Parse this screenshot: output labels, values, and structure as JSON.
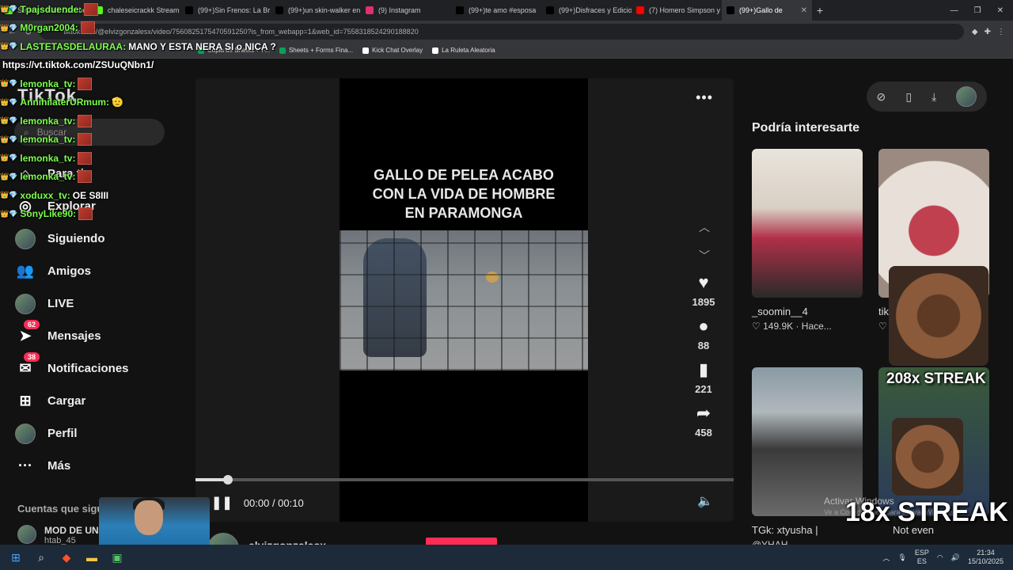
{
  "browser": {
    "tabs": [
      {
        "label": "Stream - Kick Dashbo",
        "color": "#53fc18"
      },
      {
        "label": "chaleseicrackk Stream",
        "color": "#53fc18"
      },
      {
        "label": "(99+)Sin Frenos: La Br",
        "color": "#000000"
      },
      {
        "label": "(99+)un skin-walker en",
        "color": "#000000"
      },
      {
        "label": "(9) Instagram",
        "color": "#e1306c"
      },
      {
        "label": "(99+)te amo #esposa",
        "color": "#000000"
      },
      {
        "label": "(99+)Disfraces y Edicio",
        "color": "#000000"
      },
      {
        "label": "(7) Homero Simpson y",
        "color": "#ff0000"
      },
      {
        "label": "(99+)Gallo de",
        "color": "#000000",
        "active": true
      }
    ],
    "new_tab_tooltip": "Nueva pestaña",
    "url": "tiktok.com/@elvizgonzalesx/video/7560825175470591250?is_from_webapp=1&web_id=7558318524290188820",
    "bookmarks": [
      {
        "label": "Copia de Sheets + F...",
        "color": "#0f9d58"
      },
      {
        "label": "Sheets + Forms Fina...",
        "color": "#0f9d58"
      },
      {
        "label": "Kick Chat Overlay",
        "color": "#ffffff"
      },
      {
        "label": "La Ruleta Aleatoria",
        "color": "#ffffff"
      }
    ]
  },
  "tiktok": {
    "logo": "TikTok",
    "search_placeholder": "Buscar",
    "nav": [
      {
        "icon": "home-icon",
        "glyph": "⌂",
        "label": "Para ti"
      },
      {
        "icon": "compass-icon",
        "glyph": "◎",
        "label": "Explorar"
      },
      {
        "icon": "avatar",
        "glyph": "",
        "label": "Siguiendo"
      },
      {
        "icon": "friends-icon",
        "glyph": "👥",
        "label": "Amigos"
      },
      {
        "icon": "live-avatar",
        "glyph": "",
        "label": "LIVE"
      },
      {
        "icon": "send-icon",
        "glyph": "➤",
        "label": "Mensajes",
        "badge": "62"
      },
      {
        "icon": "inbox-icon",
        "glyph": "✉",
        "label": "Notificaciones",
        "badge": "38"
      },
      {
        "icon": "plus-square-icon",
        "glyph": "⊞",
        "label": "Cargar"
      },
      {
        "icon": "avatar",
        "glyph": "",
        "label": "Perfil"
      },
      {
        "icon": "more-icon",
        "glyph": "···",
        "label": "Más"
      }
    ],
    "following_title": "Cuentas que sigues",
    "following": [
      {
        "name": "MOD DE UN STR...",
        "sub": "htab_45"
      }
    ],
    "video": {
      "title_lines": [
        "GALLO DE PELEA ACABO",
        "CON LA VIDA DE HOMBRE",
        "EN PARAMONGA"
      ],
      "likes": "1895",
      "comments": "88",
      "saves": "221",
      "shares": "458",
      "time": "00:00 / 00:10",
      "progress": 0.06,
      "creator": "elvizgonzalesx"
    },
    "recs_title": "Podría interesarte",
    "recs": [
      {
        "meta1": "_soomin__4",
        "meta2": "♡ 149.9K · Hace..."
      },
      {
        "meta1": "tik",
        "meta2": "♡"
      },
      {
        "meta1": "TGk: xtyusha |",
        "meta2": "@YHAH"
      },
      {
        "meta1": "Not even",
        "meta2": ""
      }
    ]
  },
  "overlay": {
    "chat": [
      {
        "nick": "Tpajsduende:",
        "msg": "",
        "emote": true
      },
      {
        "nick": "M0rgan2004:",
        "msg": "",
        "emote": true
      },
      {
        "nick": "LASTETASDELAURAA:",
        "msg": "MANO Y ESTA NERA SI o NICA ?",
        "emote": false
      },
      {
        "nick": "",
        "msg": "https://vt.tiktok.com/ZSUuQNbn1/",
        "emote": false,
        "url": true
      },
      {
        "nick": "lemonka_tv:",
        "msg": "",
        "emote": true
      },
      {
        "nick": "AnnihilaterURmum:",
        "msg": "🫡",
        "emote": false
      },
      {
        "nick": "lemonka_tv:",
        "msg": "",
        "emote": true
      },
      {
        "nick": "lemonka_tv:",
        "msg": "",
        "emote": true
      },
      {
        "nick": "lemonka_tv:",
        "msg": "",
        "emote": true
      },
      {
        "nick": "lemonka_tv:",
        "msg": "",
        "emote": true
      },
      {
        "nick": "xoduxx_tv:",
        "msg": "OE S8III",
        "emote": false
      },
      {
        "nick": "SonyLike90:",
        "msg": "",
        "emote": true
      }
    ],
    "streak_big": "208x STREAK",
    "streak_small": "18x STREAK",
    "watermark_title": "Activar Windows",
    "watermark_sub": "Ve a Configuración para activar Windows."
  },
  "taskbar": {
    "lang": "ESP",
    "region": "ES",
    "time": "21:34",
    "date": "15/10/2025"
  }
}
